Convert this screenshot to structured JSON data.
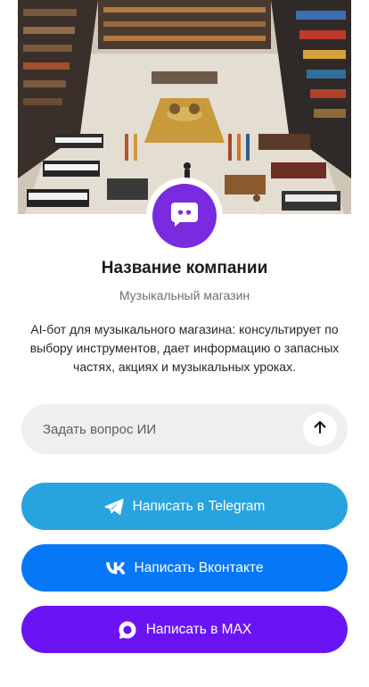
{
  "colors": {
    "telegram": "#27a3df",
    "vkontakte": "#0677f7",
    "max": "#6a14f5",
    "avatar": "#7a2be0",
    "ask_box": "#efefef"
  },
  "hero": {
    "image": "music-store-aerial-illustration"
  },
  "profile": {
    "avatar_icon": "chat-bubble-icon",
    "company_name": "Название компании",
    "category": "Музыкальный магазин",
    "description": "AI-бот для музыкального магазина: консультирует по выбору инструментов, дает информацию о запасных частях, акциях и музыкальных уроках."
  },
  "ask": {
    "placeholder": "Задать вопрос ИИ",
    "value": "",
    "send_icon": "arrow-up-icon"
  },
  "actions": {
    "telegram": {
      "label": "Написать в Telegram",
      "icon": "telegram-icon"
    },
    "vkontakte": {
      "label": "Написать Вконтакте",
      "icon": "vk-icon"
    },
    "max": {
      "label": "Написать в MAX",
      "icon": "max-icon"
    }
  }
}
